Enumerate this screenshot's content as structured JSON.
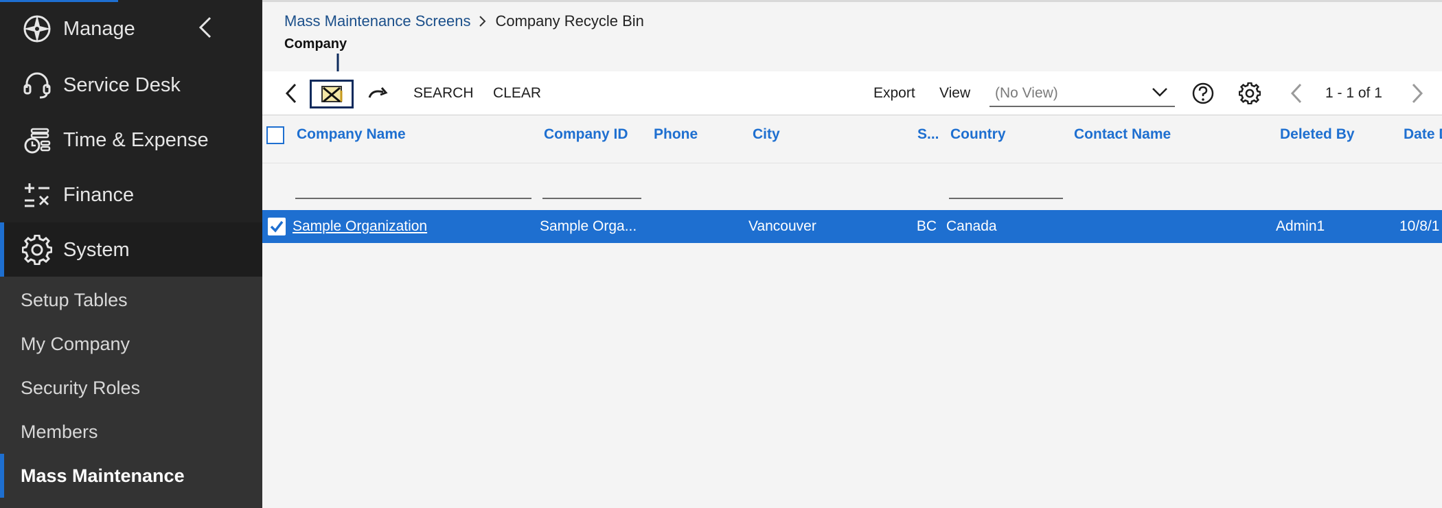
{
  "sidebar": {
    "nav": [
      {
        "label": "Manage",
        "icon": "compass-icon"
      },
      {
        "label": "Service Desk",
        "icon": "headset-icon"
      },
      {
        "label": "Time & Expense",
        "icon": "time-expense-icon"
      },
      {
        "label": "Finance",
        "icon": "finance-icon"
      },
      {
        "label": "System",
        "icon": "gear-icon"
      }
    ],
    "subnav": [
      {
        "label": "Setup Tables"
      },
      {
        "label": "My Company"
      },
      {
        "label": "Security Roles"
      },
      {
        "label": "Members"
      },
      {
        "label": "Mass Maintenance"
      }
    ]
  },
  "breadcrumb": {
    "link": "Mass Maintenance Screens",
    "current": "Company Recycle Bin"
  },
  "page_title": "Company",
  "toolbar": {
    "search_label": "SEARCH",
    "clear_label": "CLEAR",
    "export_label": "Export",
    "view_label": "View",
    "view_value": "(No View)",
    "pager_text": "1 - 1 of 1"
  },
  "grid": {
    "columns": [
      "Company Name",
      "Company ID",
      "Phone",
      "City",
      "S...",
      "Country",
      "Contact Name",
      "Deleted By",
      "Date D"
    ],
    "rows": [
      {
        "company_name": "Sample Organization",
        "company_id": "Sample Orga...",
        "phone": "",
        "city": "Vancouver",
        "state": "BC",
        "country": "Canada",
        "contact_name": "",
        "deleted_by": "Admin1",
        "date_deleted": "10/8/1"
      }
    ]
  },
  "colors": {
    "sidebar_bg": "#222222",
    "subnav_bg": "#333333",
    "accent": "#1e6fd0",
    "link": "#1b4f8a",
    "annotation": "#0d2a5c"
  }
}
